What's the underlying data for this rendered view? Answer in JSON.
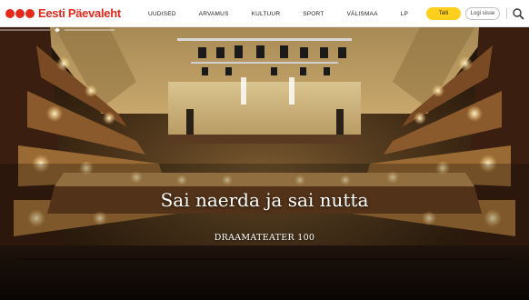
{
  "header": {
    "logo_text": "Eesti Päevaleht",
    "nav": [
      "UUDISED",
      "ARVAMUS",
      "KULTUUR",
      "SPORT",
      "VÄLISMAA",
      "LP"
    ],
    "order_label": "Telli",
    "login_label": "Logi sisse"
  },
  "hero": {
    "title": "Sai naerda ja sai nutta",
    "subtitle": "DRAAMATEATER 100"
  },
  "colors": {
    "brand_red": "#e4281b",
    "order_yellow": "#ffcf1c"
  }
}
